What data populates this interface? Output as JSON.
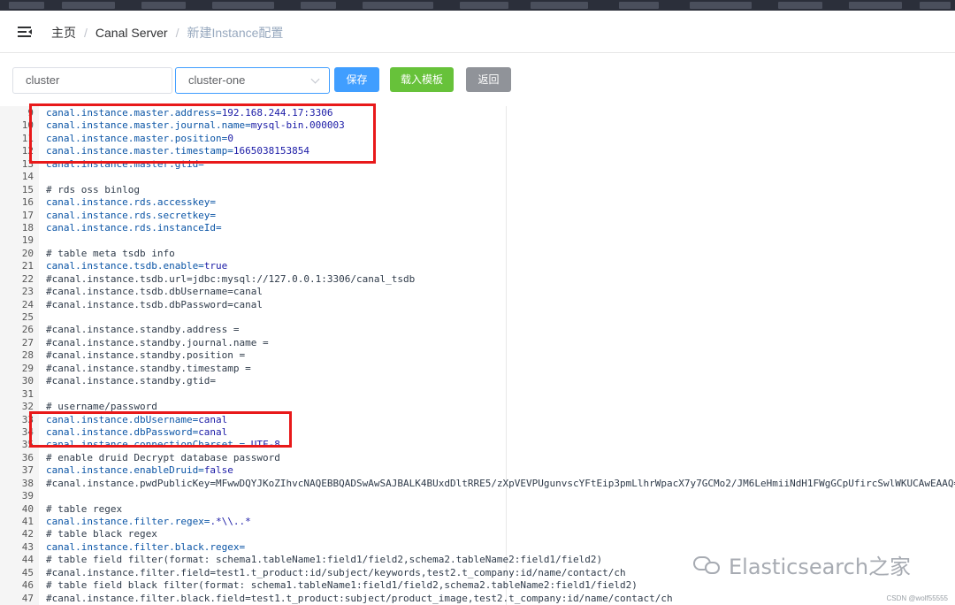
{
  "breadcrumb": {
    "home": "主页",
    "server": "Canal Server",
    "current": "新建Instance配置"
  },
  "toolbar": {
    "cluster_input_value": "cluster",
    "cluster_select_value": "cluster-one",
    "save_label": "保存",
    "load_template_label": "载入模板",
    "back_label": "返回"
  },
  "editor": {
    "lines": [
      {
        "n": "9",
        "key": "canal.instance.master.address=",
        "val": "192.168.244.17:3306"
      },
      {
        "n": "10",
        "key": "canal.instance.master.journal.name=",
        "val": "mysql-bin.000003"
      },
      {
        "n": "11",
        "key": "canal.instance.master.position=",
        "val": "0"
      },
      {
        "n": "12",
        "key": "canal.instance.master.timestamp=",
        "val": "1665038153854"
      },
      {
        "n": "13",
        "key": "canal.instance.master.gtid=",
        "val": ""
      },
      {
        "n": "14",
        "comment": ""
      },
      {
        "n": "15",
        "comment": "# rds oss binlog"
      },
      {
        "n": "16",
        "key": "canal.instance.rds.accesskey=",
        "val": ""
      },
      {
        "n": "17",
        "key": "canal.instance.rds.secretkey=",
        "val": ""
      },
      {
        "n": "18",
        "key": "canal.instance.rds.instanceId=",
        "val": ""
      },
      {
        "n": "19",
        "comment": ""
      },
      {
        "n": "20",
        "comment": "# table meta tsdb info"
      },
      {
        "n": "21",
        "key": "canal.instance.tsdb.enable=",
        "val": "true"
      },
      {
        "n": "22",
        "comment": "#canal.instance.tsdb.url=jdbc:mysql://127.0.0.1:3306/canal_tsdb"
      },
      {
        "n": "23",
        "comment": "#canal.instance.tsdb.dbUsername=canal"
      },
      {
        "n": "24",
        "comment": "#canal.instance.tsdb.dbPassword=canal"
      },
      {
        "n": "25",
        "comment": ""
      },
      {
        "n": "26",
        "comment": "#canal.instance.standby.address ="
      },
      {
        "n": "27",
        "comment": "#canal.instance.standby.journal.name ="
      },
      {
        "n": "28",
        "comment": "#canal.instance.standby.position ="
      },
      {
        "n": "29",
        "comment": "#canal.instance.standby.timestamp ="
      },
      {
        "n": "30",
        "comment": "#canal.instance.standby.gtid="
      },
      {
        "n": "31",
        "comment": ""
      },
      {
        "n": "32",
        "comment": "# username/password"
      },
      {
        "n": "33",
        "key": "canal.instance.dbUsername=",
        "val": "canal"
      },
      {
        "n": "34",
        "key": "canal.instance.dbPassword=",
        "val": "canal"
      },
      {
        "n": "35",
        "key": "canal.instance.connectionCharset = ",
        "val": "UTF-8"
      },
      {
        "n": "36",
        "comment": "# enable druid Decrypt database password"
      },
      {
        "n": "37",
        "key": "canal.instance.enableDruid=",
        "val": "false"
      },
      {
        "n": "38",
        "comment": "#canal.instance.pwdPublicKey=MFwwDQYJKoZIhvcNAQEBBQADSwAwSAJBALK4BUxdDltRRE5/zXpVEVPUgunvscYFtEip3pmLlhrWpacX7y7GCMo2/JM6LeHmiiNdH1FWgGCpUfircSwlWKUCAwEAAQ=="
      },
      {
        "n": "39",
        "comment": ""
      },
      {
        "n": "40",
        "comment": "# table regex"
      },
      {
        "n": "41",
        "key": "canal.instance.filter.regex=",
        "val": ".*\\\\..*"
      },
      {
        "n": "42",
        "comment": "# table black regex"
      },
      {
        "n": "43",
        "key": "canal.instance.filter.black.regex=",
        "val": ""
      },
      {
        "n": "44",
        "comment": "# table field filter(format: schema1.tableName1:field1/field2,schema2.tableName2:field1/field2)"
      },
      {
        "n": "45",
        "comment": "#canal.instance.filter.field=test1.t_product:id/subject/keywords,test2.t_company:id/name/contact/ch"
      },
      {
        "n": "46",
        "comment": "# table field black filter(format: schema1.tableName1:field1/field2,schema2.tableName2:field1/field2)"
      },
      {
        "n": "47",
        "comment": "#canal.instance.filter.black.field=test1.t_product:subject/product_image,test2.t_company:id/name/contact/ch"
      }
    ]
  },
  "watermark": {
    "text": "Elasticsearch之家",
    "credit": "CSDN @wolf55555"
  },
  "colors": {
    "highlight": "#e8191a",
    "primary": "#409eff",
    "success": "#67c23a",
    "info": "#909399"
  },
  "icons": [
    "menu-fold-icon",
    "chevron-down-icon",
    "wechat-icon"
  ]
}
